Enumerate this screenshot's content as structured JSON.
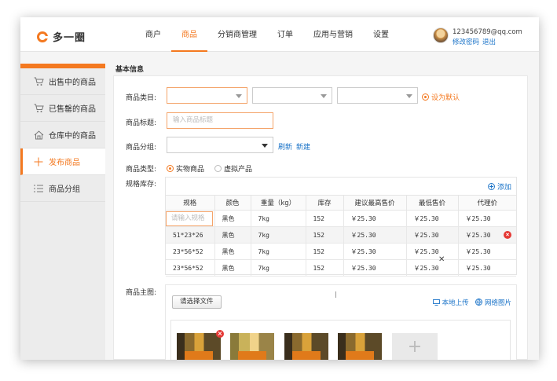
{
  "logo": {
    "text": "多一圈"
  },
  "nav": {
    "items": [
      {
        "label": "商户",
        "active": false
      },
      {
        "label": "商品",
        "active": true
      },
      {
        "label": "分销商管理",
        "active": false
      },
      {
        "label": "订单",
        "active": false
      },
      {
        "label": "应用与营销",
        "active": false
      },
      {
        "label": "设置",
        "active": false
      }
    ]
  },
  "user": {
    "email": "123456789@qq.com",
    "change_password": "修改密码",
    "logout": "退出"
  },
  "sidebar": {
    "items": [
      {
        "label": "出售中的商品",
        "icon": "cart-icon",
        "glyph": "🛒",
        "active": false
      },
      {
        "label": "已售罄的商品",
        "icon": "cart-empty-icon",
        "glyph": "🛒",
        "active": false
      },
      {
        "label": "仓库中的商品",
        "icon": "warehouse-icon",
        "glyph": "⌂",
        "active": false
      },
      {
        "label": "发布商品",
        "icon": "plus-icon",
        "glyph": "+",
        "active": true
      },
      {
        "label": "商品分组",
        "icon": "list-icon",
        "glyph": "☰",
        "active": false
      }
    ]
  },
  "form": {
    "section_title": "基本信息",
    "category_label": "商品类目:",
    "set_default": "设为默认",
    "title_label": "商品标题:",
    "title_placeholder": "输入商品标题",
    "group_label": "商品分组:",
    "refresh": "刷新",
    "new": "新建",
    "type_label": "商品类型:",
    "type_options": [
      "实物商品",
      "虚拟产品"
    ],
    "selected_type": "实物商品",
    "stock_label": "规格库存:",
    "image_label": "商品主图:"
  },
  "spec_table": {
    "add_label": "添加",
    "headers": [
      "规格",
      "颜色",
      "重量（kg）",
      "库存",
      "建议最高售价",
      "最低售价",
      "代理价"
    ],
    "first_placeholder": "请输入规格",
    "rows": [
      [
        "",
        "黑色",
        "7kg",
        "152",
        "￥25.30",
        "￥25.30",
        "￥25.30"
      ],
      [
        "51*23*26",
        "黑色",
        "7kg",
        "152",
        "￥25.30",
        "￥25.30",
        "￥25.30"
      ],
      [
        "23*56*52",
        "黑色",
        "7kg",
        "152",
        "￥25.30",
        "￥25.30",
        "￥25.30"
      ],
      [
        "23*56*52",
        "黑色",
        "7kg",
        "152",
        "￥25.30",
        "￥25.30",
        "￥25.30"
      ]
    ]
  },
  "images": {
    "choose_file": "请选择文件",
    "local_upload": "本地上传",
    "network_image": "网络图片",
    "thumb_count": 4
  },
  "colors": {
    "accent": "#f47920",
    "link": "#1a73c8",
    "danger": "#e53935"
  }
}
